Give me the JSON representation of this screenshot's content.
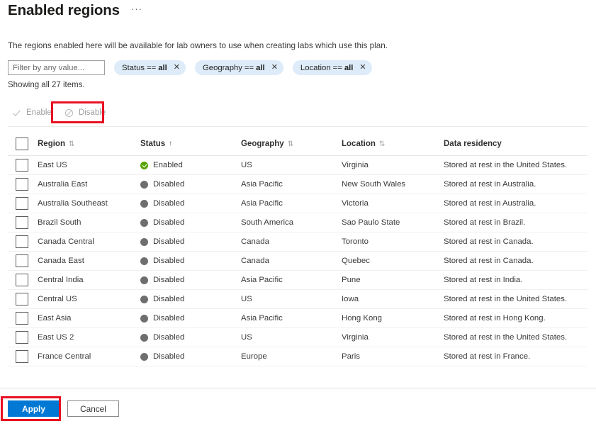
{
  "header": {
    "title": "Enabled regions",
    "more_label": "···"
  },
  "description": "The regions enabled here will be available for lab owners to use when creating labs which use this plan.",
  "filter": {
    "placeholder": "Filter by any value...",
    "value": "",
    "pills": [
      {
        "field": "Status",
        "op": "==",
        "value": "all",
        "close": "✕"
      },
      {
        "field": "Geography",
        "op": "==",
        "value": "all",
        "close": "✕"
      },
      {
        "field": "Location",
        "op": "==",
        "value": "all",
        "close": "✕"
      }
    ]
  },
  "showing": "Showing all 27 items.",
  "command_bar": {
    "enable_label": "Enable",
    "enable_icon": "checkmark-icon",
    "disable_label": "Disable",
    "disable_icon": "block-circle-icon"
  },
  "table": {
    "columns": [
      {
        "label": "Region",
        "sort": "both"
      },
      {
        "label": "Status",
        "sort": "asc"
      },
      {
        "label": "Geography",
        "sort": "both"
      },
      {
        "label": "Location",
        "sort": "both"
      },
      {
        "label": "Data residency",
        "sort": "none"
      }
    ],
    "sort_glyph_both": "⇅",
    "sort_glyph_asc": "↑",
    "rows": [
      {
        "region": "East US",
        "status": "Enabled",
        "geography": "US",
        "location": "Virginia",
        "residency": "Stored at rest in the United States."
      },
      {
        "region": "Australia East",
        "status": "Disabled",
        "geography": "Asia Pacific",
        "location": "New South Wales",
        "residency": "Stored at rest in Australia."
      },
      {
        "region": "Australia Southeast",
        "status": "Disabled",
        "geography": "Asia Pacific",
        "location": "Victoria",
        "residency": "Stored at rest in Australia."
      },
      {
        "region": "Brazil South",
        "status": "Disabled",
        "geography": "South America",
        "location": "Sao Paulo State",
        "residency": "Stored at rest in Brazil."
      },
      {
        "region": "Canada Central",
        "status": "Disabled",
        "geography": "Canada",
        "location": "Toronto",
        "residency": "Stored at rest in Canada."
      },
      {
        "region": "Canada East",
        "status": "Disabled",
        "geography": "Canada",
        "location": "Quebec",
        "residency": "Stored at rest in Canada."
      },
      {
        "region": "Central India",
        "status": "Disabled",
        "geography": "Asia Pacific",
        "location": "Pune",
        "residency": "Stored at rest in India."
      },
      {
        "region": "Central US",
        "status": "Disabled",
        "geography": "US",
        "location": "Iowa",
        "residency": "Stored at rest in the United States."
      },
      {
        "region": "East Asia",
        "status": "Disabled",
        "geography": "Asia Pacific",
        "location": "Hong Kong",
        "residency": "Stored at rest in Hong Kong."
      },
      {
        "region": "East US 2",
        "status": "Disabled",
        "geography": "US",
        "location": "Virginia",
        "residency": "Stored at rest in the United States."
      },
      {
        "region": "France Central",
        "status": "Disabled",
        "geography": "Europe",
        "location": "Paris",
        "residency": "Stored at rest in France."
      }
    ]
  },
  "footer": {
    "apply_label": "Apply",
    "cancel_label": "Cancel"
  },
  "colors": {
    "accent": "#0078d4",
    "status_enabled": "#57a300",
    "status_disabled": "#6e6e6e",
    "pill_background": "#deecf9",
    "annotation": "#e81123"
  }
}
